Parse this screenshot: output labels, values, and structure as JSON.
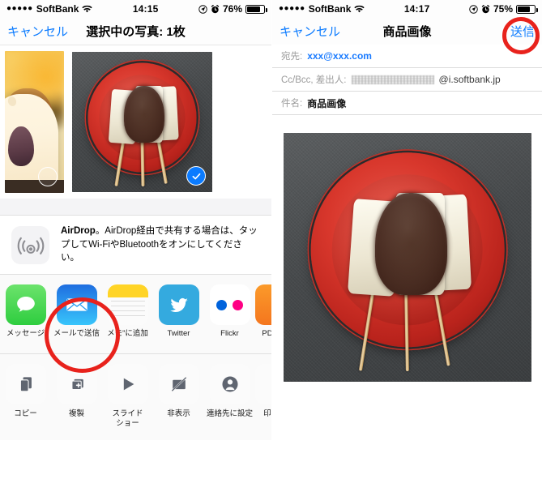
{
  "left_panel": {
    "statusbar": {
      "signal_dots": "●●●●●",
      "carrier": "SoftBank",
      "wifi_icon": "wifi-icon",
      "time": "14:15",
      "location_icon": "location-arrow-icon",
      "alarm_icon": "alarm-clock-icon",
      "battery_percent": "76%",
      "battery_level": 76
    },
    "navbar": {
      "cancel_label": "キャンセル",
      "title": "選択中の写真: 1枚"
    },
    "thumbnails": [
      {
        "name": "thumbnail-anpan",
        "selected": false,
        "badge_icon": "circle-outline-icon"
      },
      {
        "name": "thumbnail-dango",
        "selected": true,
        "badge_icon": "check-circle-icon"
      }
    ],
    "airdrop": {
      "icon": "airdrop-icon",
      "title": "AirDrop",
      "description": "。AirDrop経由で共有する場合は、タップしてWi-FiやBluetoothをオンにしてください。"
    },
    "share_apps": [
      {
        "name": "messages",
        "label": "メッセージ",
        "icon": "messages-icon",
        "color": "#5ad45a"
      },
      {
        "name": "mail",
        "label": "メールで送信",
        "icon": "mail-icon",
        "color": "#1b86f5",
        "highlighted": true
      },
      {
        "name": "notes",
        "label": "メモ\"に追加",
        "icon": "notes-icon",
        "color": "#ffd426"
      },
      {
        "name": "twitter",
        "label": "Twitter",
        "icon": "twitter-icon",
        "color": "#34aadf"
      },
      {
        "name": "flickr",
        "label": "Flickr",
        "icon": "flickr-icon",
        "color": "#ffffff"
      },
      {
        "name": "pdf",
        "label": "PD",
        "icon": "pdf-icon",
        "color": "#f77d1e"
      }
    ],
    "actions": [
      {
        "name": "copy",
        "label": "コピー",
        "icon": "copy-icon"
      },
      {
        "name": "duplicate",
        "label": "複製",
        "icon": "duplicate-plus-icon"
      },
      {
        "name": "slideshow",
        "label": "スライド\nショー",
        "label_line1": "スライド",
        "label_line2": "ショー",
        "icon": "play-triangle-icon"
      },
      {
        "name": "hide",
        "label": "非表示",
        "icon": "hide-slash-icon"
      },
      {
        "name": "assign-to-contact",
        "label": "連絡先に設定",
        "icon": "contact-person-icon"
      },
      {
        "name": "more",
        "label": "印",
        "icon": "printer-icon"
      }
    ],
    "annotation": {
      "name": "red-circle-mail",
      "color": "#e8221c"
    }
  },
  "right_panel": {
    "statusbar": {
      "signal_dots": "●●●●●",
      "carrier": "SoftBank",
      "wifi_icon": "wifi-icon",
      "time": "14:17",
      "location_icon": "location-arrow-icon",
      "alarm_icon": "alarm-clock-icon",
      "battery_percent": "75%",
      "battery_level": 75
    },
    "navbar": {
      "cancel_label": "キャンセル",
      "title": "商品画像",
      "send_label": "送信"
    },
    "fields": {
      "to_label": "宛先:",
      "to_value": "xxx@xxx.com",
      "ccbcc_label": "Cc/Bcc, 差出人:",
      "ccbcc_value_redacted": "redacted-address",
      "ccbcc_domain": "@i.softbank.jp",
      "subject_label": "件名:",
      "subject_value": "商品画像"
    },
    "body": {
      "attachment_name": "attached-photo-dango"
    },
    "annotation": {
      "name": "red-circle-send",
      "color": "#e8221c"
    }
  },
  "colors": {
    "ios_blue": "#0b7bff",
    "annotation_red": "#e8221c",
    "panel_bg": "#ffffff",
    "section_bg": "#fafafa"
  }
}
